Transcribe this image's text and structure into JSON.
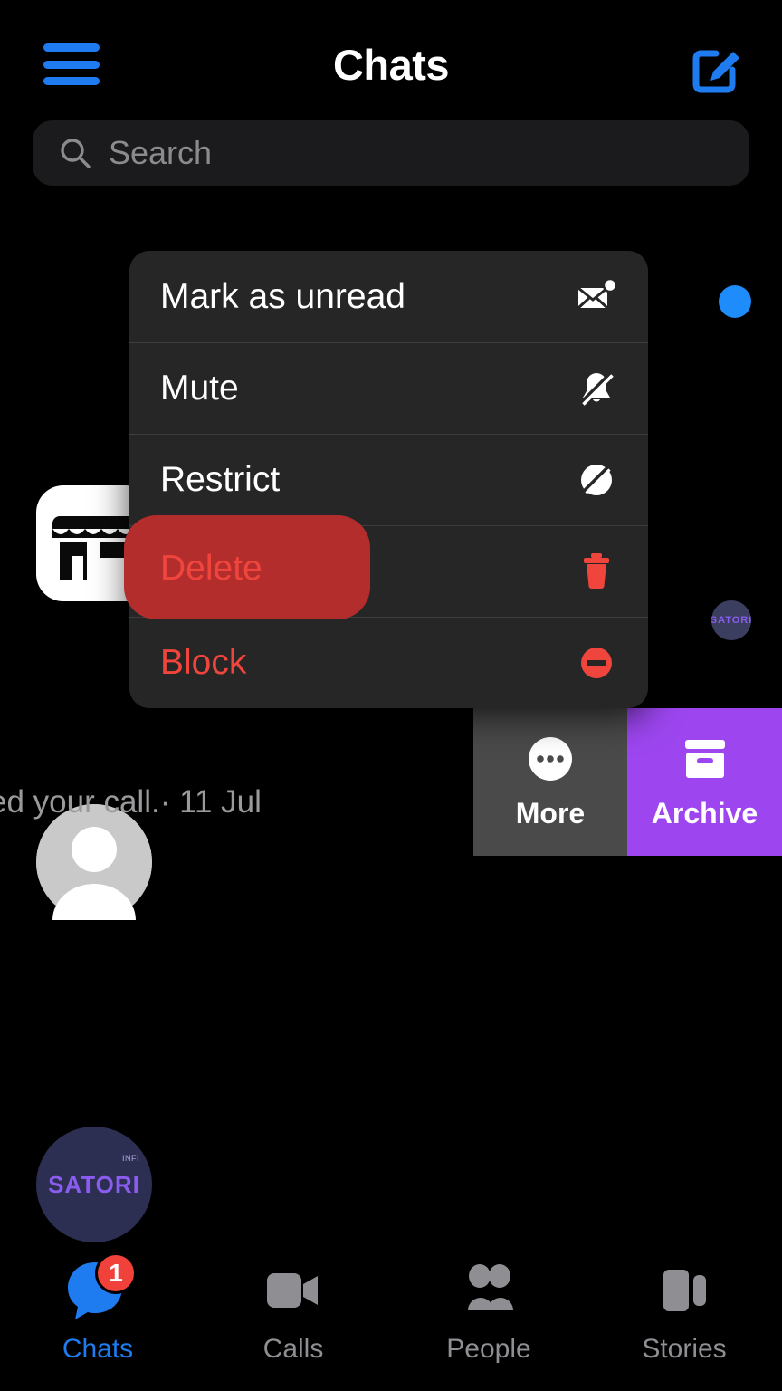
{
  "header": {
    "title": "Chats",
    "menu_icon": "hamburger-icon",
    "compose_icon": "compose-icon"
  },
  "search": {
    "placeholder": "Search",
    "value": "",
    "icon": "search-icon"
  },
  "chat_list": [
    {
      "avatar_type": "marketplace-store-icon",
      "unread": true,
      "snippet": "",
      "timestamp": ""
    },
    {
      "avatar_type": "default-person-avatar",
      "unread": false,
      "snippet": "",
      "timestamp": ""
    },
    {
      "avatar_type": "satori-logo-avatar",
      "avatar_text": "SATORI",
      "avatar_superscript": "INFI",
      "unread": false,
      "snippet": "ed your call.· 11 Jul",
      "timestamp": "11 Jul"
    }
  ],
  "visible_snippet": "ed your call.· 11 Jul",
  "context_menu": {
    "items": [
      {
        "label": "Mark as unread",
        "icon": "mail-unread-icon",
        "danger": false
      },
      {
        "label": "Mute",
        "icon": "bell-slash-icon",
        "danger": false
      },
      {
        "label": "Restrict",
        "icon": "circle-slash-icon",
        "danger": false
      },
      {
        "label": "Delete",
        "icon": "trash-icon",
        "danger": true,
        "highlighted": true
      },
      {
        "label": "Block",
        "icon": "block-icon",
        "danger": true
      }
    ]
  },
  "swipe_actions": [
    {
      "label": "More",
      "icon": "ellipsis-circle-icon",
      "color": "#4a4a4a"
    },
    {
      "label": "Archive",
      "icon": "archive-box-icon",
      "color": "#9d46f0"
    }
  ],
  "tabbar": {
    "tabs": [
      {
        "label": "Chats",
        "icon": "chat-bubble-icon",
        "active": true,
        "badge": "1"
      },
      {
        "label": "Calls",
        "icon": "video-camera-icon",
        "active": false,
        "badge": ""
      },
      {
        "label": "People",
        "icon": "people-icon",
        "active": false,
        "badge": ""
      },
      {
        "label": "Stories",
        "icon": "stories-icon",
        "active": false,
        "badge": ""
      }
    ]
  },
  "colors": {
    "accent_blue": "#1e7bf0",
    "danger_red": "#f0453c",
    "highlight_red": "#b32d2d",
    "archive_purple": "#9d46f0",
    "more_gray": "#4a4a4a",
    "menu_bg": "#262626",
    "background": "#000000"
  }
}
